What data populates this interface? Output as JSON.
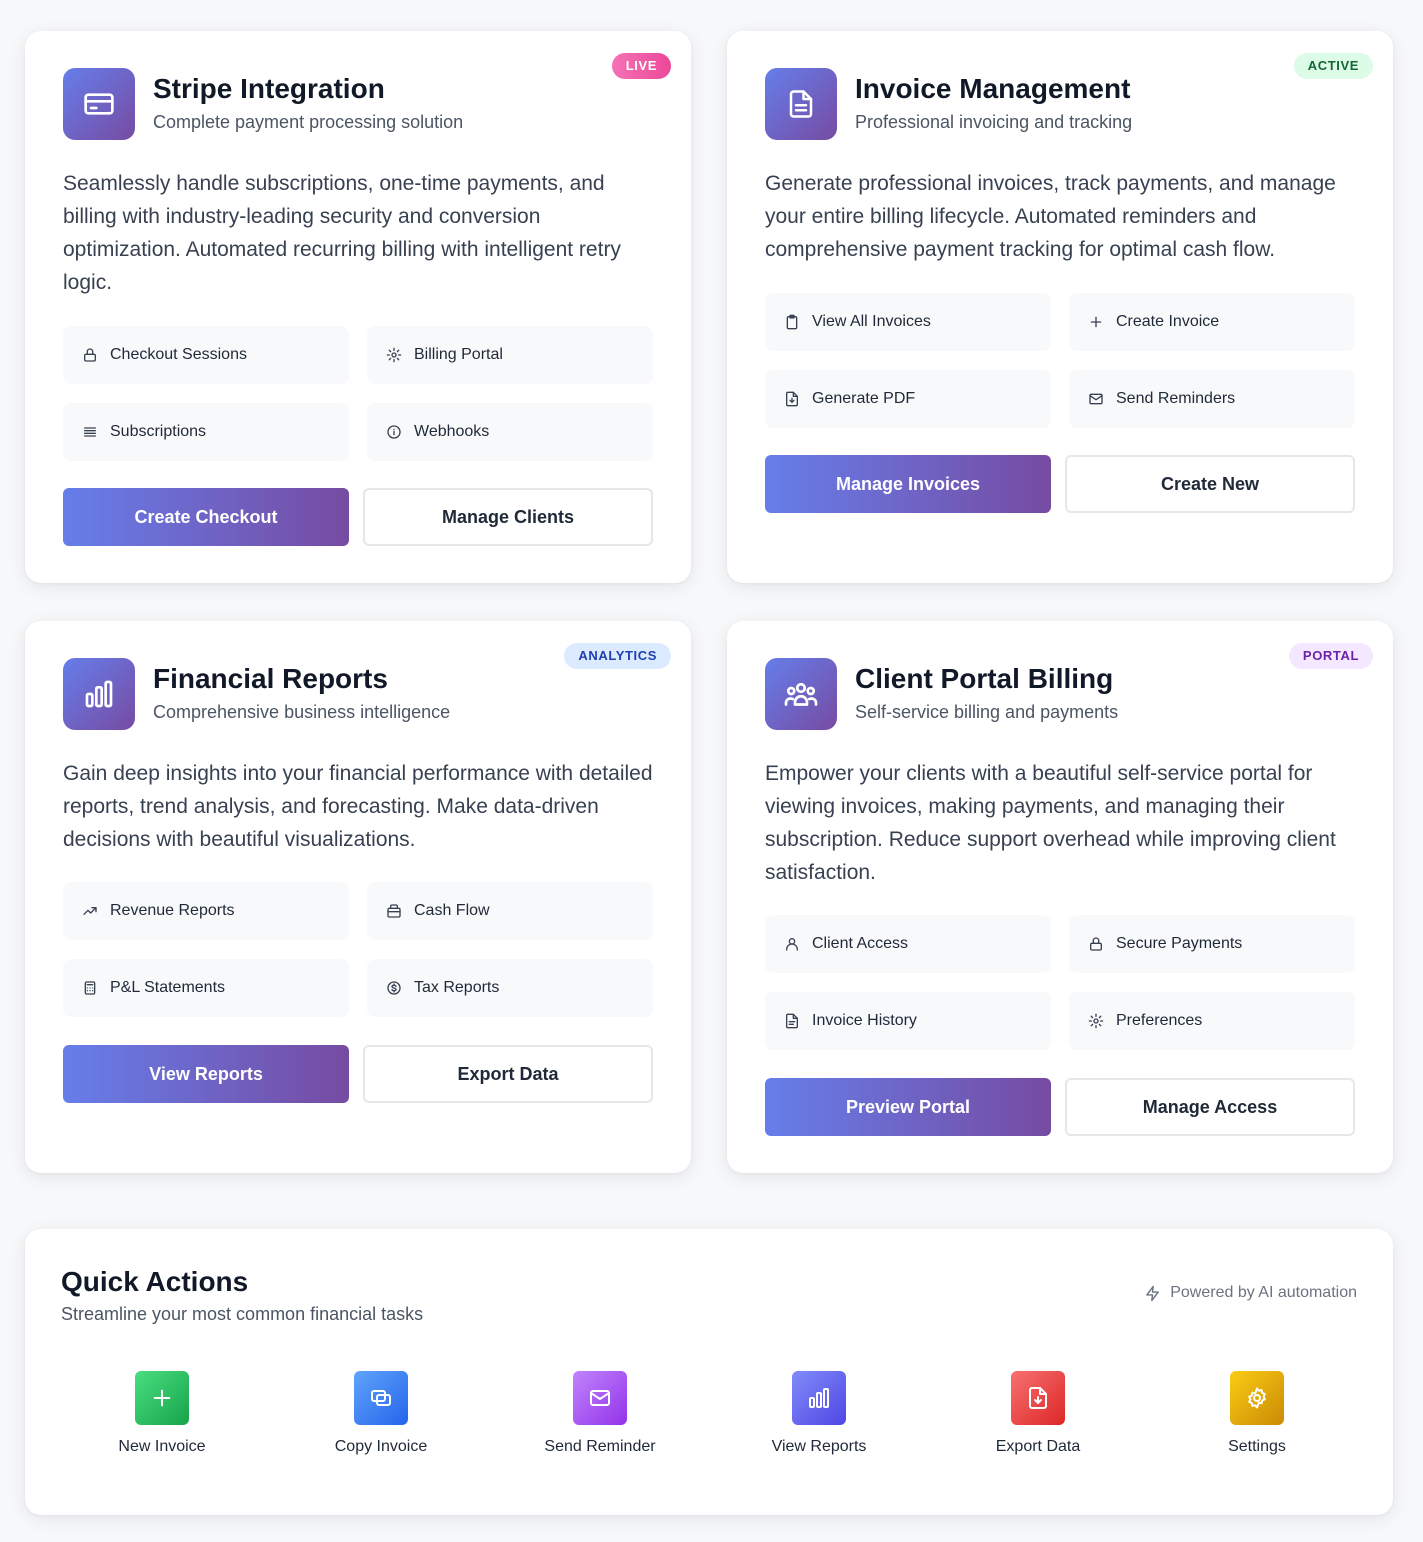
{
  "cards": [
    {
      "badge": "LIVE",
      "title": "Stripe Integration",
      "subtitle": "Complete payment processing solution",
      "description": "Seamlessly handle subscriptions, one-time payments, and billing with industry-leading security and conversion optimization. Automated recurring billing with intelligent retry logic.",
      "features": [
        {
          "label": "Checkout Sessions",
          "icon": "lock-icon"
        },
        {
          "label": "Billing Portal",
          "icon": "gear-icon"
        },
        {
          "label": "Subscriptions",
          "icon": "list-icon"
        },
        {
          "label": "Webhooks",
          "icon": "info-icon"
        }
      ],
      "primary_button": "Create Checkout",
      "secondary_button": "Manage Clients"
    },
    {
      "badge": "ACTIVE",
      "title": "Invoice Management",
      "subtitle": "Professional invoicing and tracking",
      "description": "Generate professional invoices, track payments, and manage your entire billing lifecycle. Automated reminders and comprehensive payment tracking for optimal cash flow.",
      "features": [
        {
          "label": "View All Invoices",
          "icon": "clipboard-icon"
        },
        {
          "label": "Create Invoice",
          "icon": "plus-icon"
        },
        {
          "label": "Generate PDF",
          "icon": "file-download-icon"
        },
        {
          "label": "Send Reminders",
          "icon": "mail-icon"
        }
      ],
      "primary_button": "Manage Invoices",
      "secondary_button": "Create New"
    },
    {
      "badge": "ANALYTICS",
      "title": "Financial Reports",
      "subtitle": "Comprehensive business intelligence",
      "description": "Gain deep insights into your financial performance with detailed reports, trend analysis, and forecasting. Make data-driven decisions with beautiful visualizations.",
      "features": [
        {
          "label": "Revenue Reports",
          "icon": "trending-up-icon"
        },
        {
          "label": "Cash Flow",
          "icon": "wallet-icon"
        },
        {
          "label": "P&L Statements",
          "icon": "calculator-icon"
        },
        {
          "label": "Tax Reports",
          "icon": "dollar-circle-icon"
        }
      ],
      "primary_button": "View Reports",
      "secondary_button": "Export Data"
    },
    {
      "badge": "PORTAL",
      "title": "Client Portal Billing",
      "subtitle": "Self-service billing and payments",
      "description": "Empower your clients with a beautiful self-service portal for viewing invoices, making payments, and managing their subscription. Reduce support overhead while improving client satisfaction.",
      "features": [
        {
          "label": "Client Access",
          "icon": "user-icon"
        },
        {
          "label": "Secure Payments",
          "icon": "lock-icon"
        },
        {
          "label": "Invoice History",
          "icon": "file-icon"
        },
        {
          "label": "Preferences",
          "icon": "gear-icon"
        }
      ],
      "primary_button": "Preview Portal",
      "secondary_button": "Manage Access"
    }
  ],
  "quick_actions": {
    "title": "Quick Actions",
    "subtitle": "Streamline your most common financial tasks",
    "powered_by": "Powered by AI automation",
    "actions": [
      {
        "label": "New Invoice",
        "icon": "plus-icon",
        "color": "#22c55e"
      },
      {
        "label": "Copy Invoice",
        "icon": "copy-icon",
        "color": "#3b82f6"
      },
      {
        "label": "Send Reminder",
        "icon": "mail-icon",
        "color": "#a855f7"
      },
      {
        "label": "View Reports",
        "icon": "bar-chart-icon",
        "color": "#6366f1"
      },
      {
        "label": "Export Data",
        "icon": "file-download-icon",
        "color": "#ef4444"
      },
      {
        "label": "Settings",
        "icon": "gear-icon",
        "color": "#eab308"
      }
    ]
  },
  "colors": {
    "accent_start": "#667eea",
    "accent_end": "#764ba2",
    "badge_live": "#ec4899",
    "badge_active_bg": "#dcfce7",
    "badge_analytics_bg": "#dbeafe",
    "badge_portal_bg": "#f3e8ff"
  }
}
